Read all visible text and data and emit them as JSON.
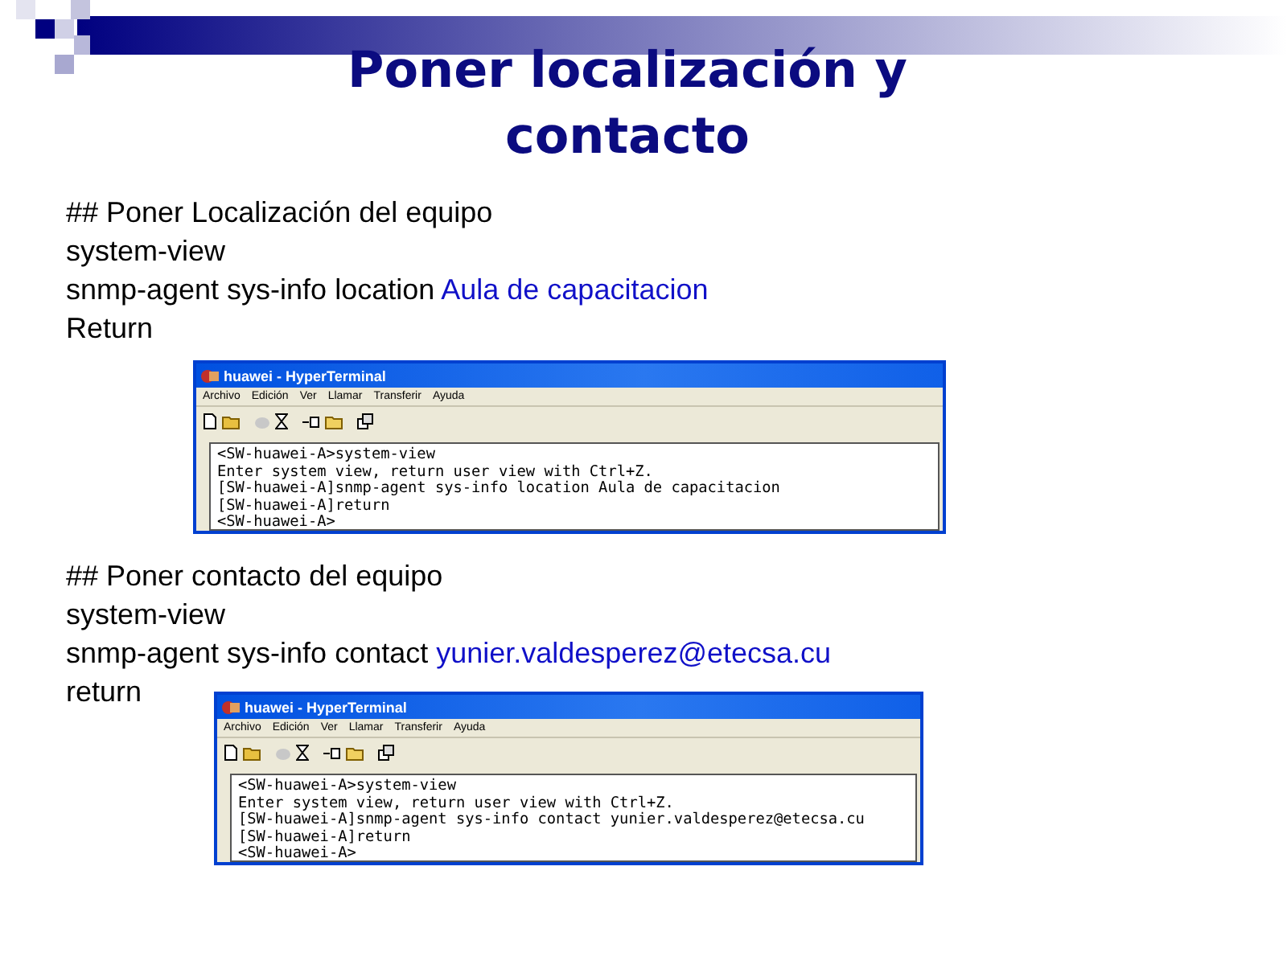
{
  "title": "Poner localización y contacto",
  "sections": [
    {
      "lines": [
        {
          "text": "## Poner Localización del equipo"
        },
        {
          "text": "system-view"
        },
        {
          "text": "snmp-agent sys-info location ",
          "value": "Aula de capacitacion"
        },
        {
          "text": "Return"
        }
      ],
      "terminal": {
        "title": "huawei - HyperTerminal",
        "menu": [
          "Archivo",
          "Edición",
          "Ver",
          "Llamar",
          "Transferir",
          "Ayuda"
        ],
        "lines": [
          "<SW-huawei-A>system-view",
          "Enter system view, return user view with Ctrl+Z.",
          "[SW-huawei-A]snmp-agent sys-info location Aula de capacitacion",
          "[SW-huawei-A]return",
          "<SW-huawei-A>"
        ]
      }
    },
    {
      "lines": [
        {
          "text": "## Poner contacto del equipo"
        },
        {
          "text": "system-view"
        },
        {
          "text": "snmp-agent sys-info contact ",
          "value": "yunier.valdesperez@etecsa.cu"
        },
        {
          "text": "return"
        }
      ],
      "terminal": {
        "title": "huawei - HyperTerminal",
        "menu": [
          "Archivo",
          "Edición",
          "Ver",
          "Llamar",
          "Transferir",
          "Ayuda"
        ],
        "lines": [
          "<SW-huawei-A>system-view",
          "Enter system view, return user view with Ctrl+Z.",
          "[SW-huawei-A]snmp-agent sys-info contact yunier.valdesperez@etecsa.cu",
          "[SW-huawei-A]return",
          "<SW-huawei-A>"
        ]
      }
    }
  ]
}
